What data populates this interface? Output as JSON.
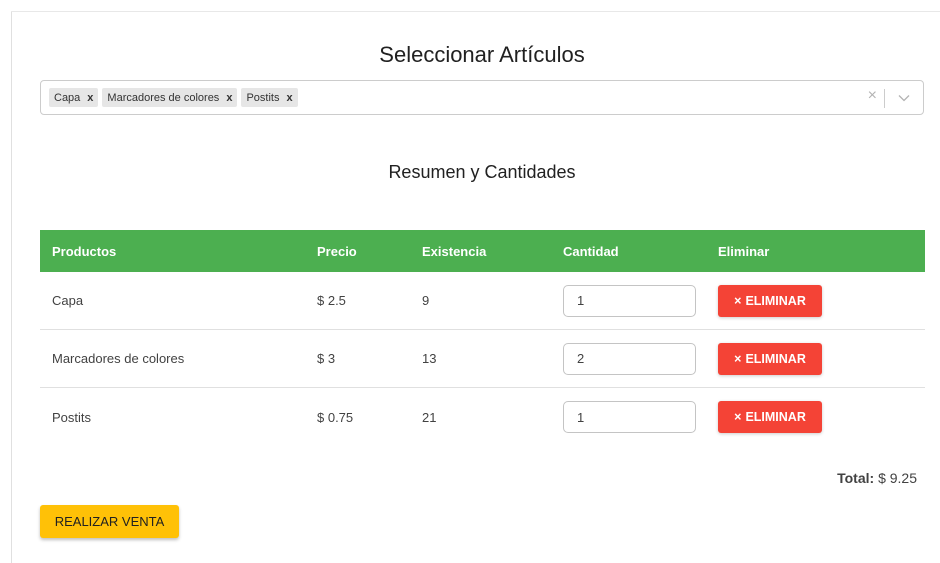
{
  "header": {
    "title": "Seleccionar Artículos"
  },
  "selector": {
    "chips": [
      {
        "label": "Capa",
        "remove": "x"
      },
      {
        "label": "Marcadores de colores",
        "remove": "x"
      },
      {
        "label": "Postits",
        "remove": "x"
      }
    ],
    "clear_icon": "×"
  },
  "summary": {
    "title": "Resumen y Cantidades"
  },
  "table": {
    "columns": [
      "Productos",
      "Precio",
      "Existencia",
      "Cantidad",
      "Eliminar"
    ],
    "rows": [
      {
        "product": "Capa",
        "price": "$ 2.5",
        "stock": "9",
        "quantity": "1",
        "delete_label": "ELIMINAR"
      },
      {
        "product": "Marcadores de colores",
        "price": "$ 3",
        "stock": "13",
        "quantity": "2",
        "delete_label": "ELIMINAR"
      },
      {
        "product": "Postits",
        "price": "$ 0.75",
        "stock": "21",
        "quantity": "1",
        "delete_label": "ELIMINAR"
      }
    ],
    "header_color": "#4caf50",
    "delete_color": "#f44336"
  },
  "total": {
    "label": "Total:",
    "value": "$ 9.25"
  },
  "actions": {
    "sale_label": "REALIZAR VENTA",
    "sale_color": "#ffc107"
  }
}
